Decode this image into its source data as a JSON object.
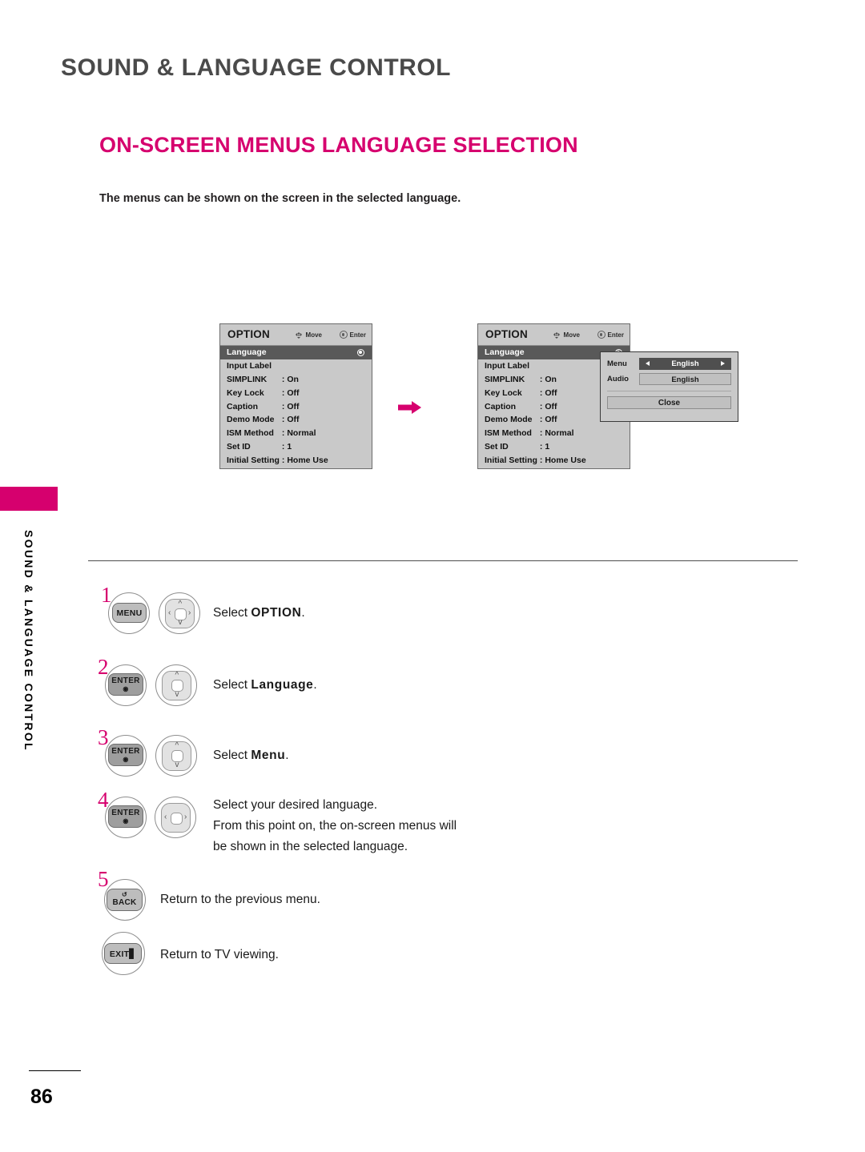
{
  "chapter": {
    "title": "SOUND & LANGUAGE CONTROL"
  },
  "section": {
    "title": "ON-SCREEN MENUS LANGUAGE SELECTION",
    "intro": "The menus can be shown on the screen in the selected language."
  },
  "side_tab": {
    "label": "SOUND & LANGUAGE CONTROL",
    "color": "#d6006e"
  },
  "osd": {
    "title": "OPTION",
    "hint_move": "Move",
    "hint_enter": "Enter",
    "selected_row": "Language",
    "rows": [
      {
        "label": "Language",
        "value": ""
      },
      {
        "label": "Input Label",
        "value": ""
      },
      {
        "label": "SIMPLINK",
        "value": ": On"
      },
      {
        "label": "Key Lock",
        "value": ": Off"
      },
      {
        "label": "Caption",
        "value": ": Off"
      },
      {
        "label": "Demo Mode",
        "value": ": Off"
      },
      {
        "label": "ISM Method",
        "value": ": Normal"
      },
      {
        "label": "Set ID",
        "value": ": 1"
      },
      {
        "label": "Initial Setting",
        "value": ": Home Use"
      }
    ]
  },
  "popup": {
    "menu_label": "Menu",
    "menu_value": "English",
    "audio_label": "Audio",
    "audio_value": "English",
    "close_label": "Close"
  },
  "steps": [
    {
      "num": "1",
      "key": "MENU",
      "pad": "4way",
      "lines": [
        {
          "pre": "Select ",
          "bold": "OPTION",
          "post": "."
        }
      ]
    },
    {
      "num": "2",
      "key": "ENTER",
      "pad": "updown",
      "lines": [
        {
          "pre": "Select ",
          "bold": "Language",
          "post": "."
        }
      ]
    },
    {
      "num": "3",
      "key": "ENTER",
      "pad": "updown",
      "lines": [
        {
          "pre": "Select ",
          "bold": "Menu",
          "post": "."
        }
      ]
    },
    {
      "num": "4",
      "key": "ENTER",
      "pad": "leftright",
      "lines": [
        {
          "pre": "Select your desired language.",
          "bold": "",
          "post": ""
        },
        {
          "pre": "From this point on, the on-screen menus will",
          "bold": "",
          "post": ""
        },
        {
          "pre": "be shown in the selected language.",
          "bold": "",
          "post": ""
        }
      ]
    },
    {
      "num": "5",
      "key": "BACK",
      "pad": "",
      "lines": [
        {
          "pre": "Return to the previous menu.",
          "bold": "",
          "post": ""
        }
      ]
    },
    {
      "num": "",
      "key": "EXIT",
      "pad": "",
      "lines": [
        {
          "pre": "Return to TV viewing.",
          "bold": "",
          "post": ""
        }
      ]
    }
  ],
  "footer": {
    "page_number": "86"
  },
  "icons": {
    "move": "dpad-move-icon",
    "enter": "enter-dot-icon",
    "flow": "pink-right-arrow-icon",
    "back": "back-curve-arrow-icon",
    "exit": "exit-door-icon"
  }
}
